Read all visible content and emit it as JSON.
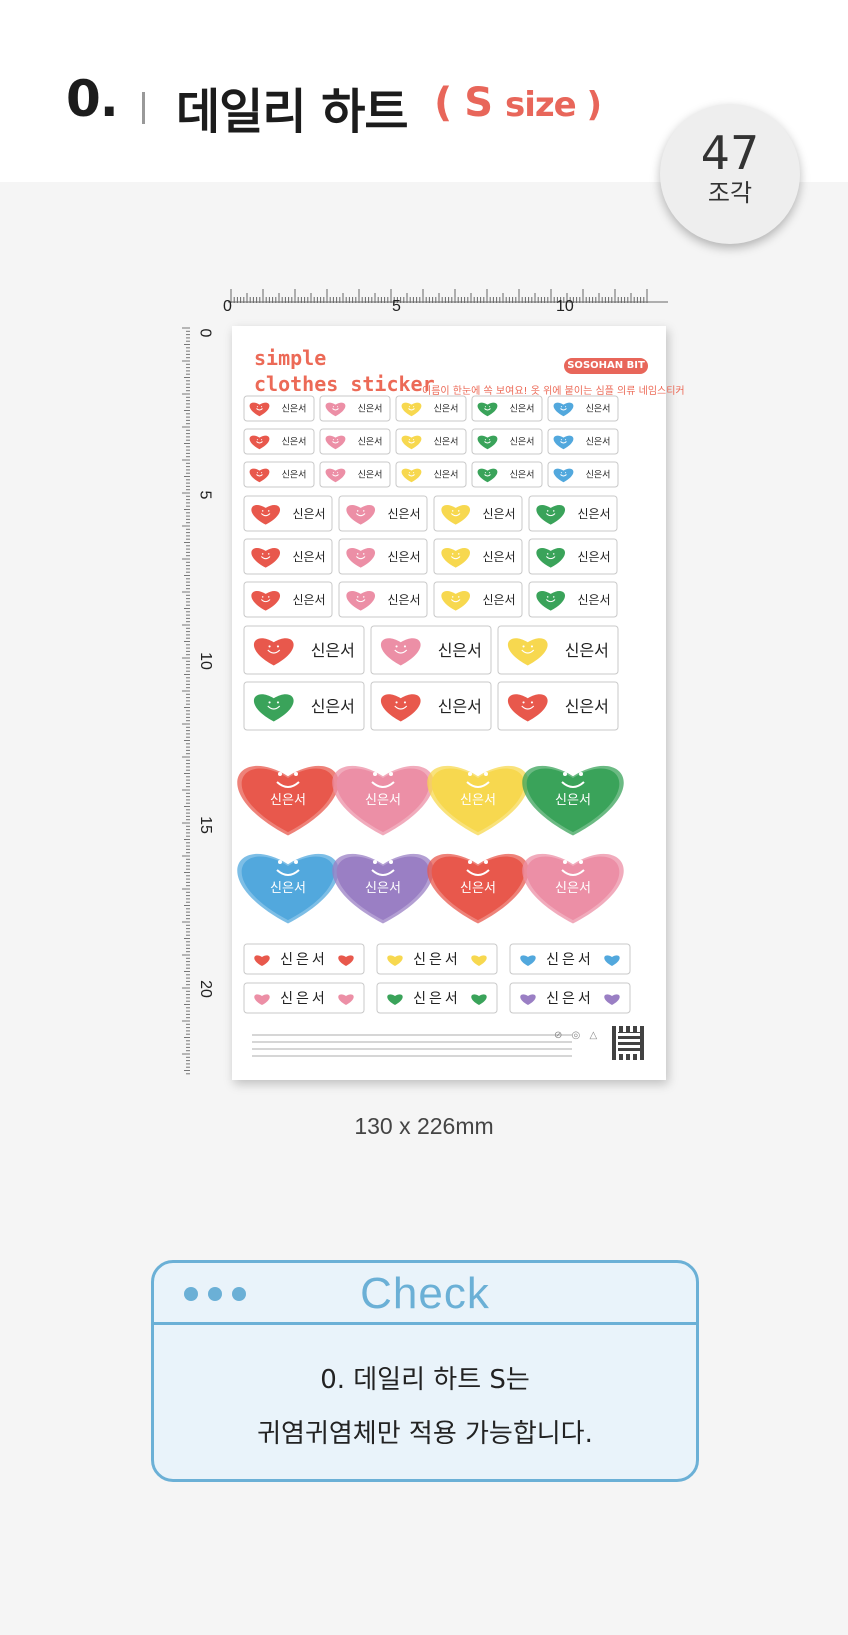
{
  "header": {
    "number": "0.",
    "title": "데일리 하트",
    "size_open": "( S",
    "size_rest": "size )"
  },
  "badge": {
    "count": "47",
    "unit": "조각"
  },
  "ruler": {
    "top_labels": [
      "0",
      "5",
      "10"
    ],
    "left_labels": [
      "0",
      "5",
      "10",
      "15",
      "20"
    ]
  },
  "sheet": {
    "brand_line1": "simple",
    "brand_line2": "clothes sticker",
    "logo": "SOSOHAN BIT",
    "tagline": "이름이 한눈에 쏙 보여요! 옷 위에 붙이는 심플 의류 네임스티커",
    "sample_name": "신은서",
    "colors": {
      "red": "#e8584c",
      "pink": "#ec8fa6",
      "yellow": "#f7d84f",
      "green": "#3aa35a",
      "blue": "#52a8dd",
      "purple": "#9a7fc4",
      "outline": "#c9c9c9"
    }
  },
  "dimensions": "130 x 226mm",
  "check": {
    "title": "Check",
    "line1": "0. 데일리 하트 S는",
    "line2": "귀염귀염체만 적용 가능합니다."
  }
}
